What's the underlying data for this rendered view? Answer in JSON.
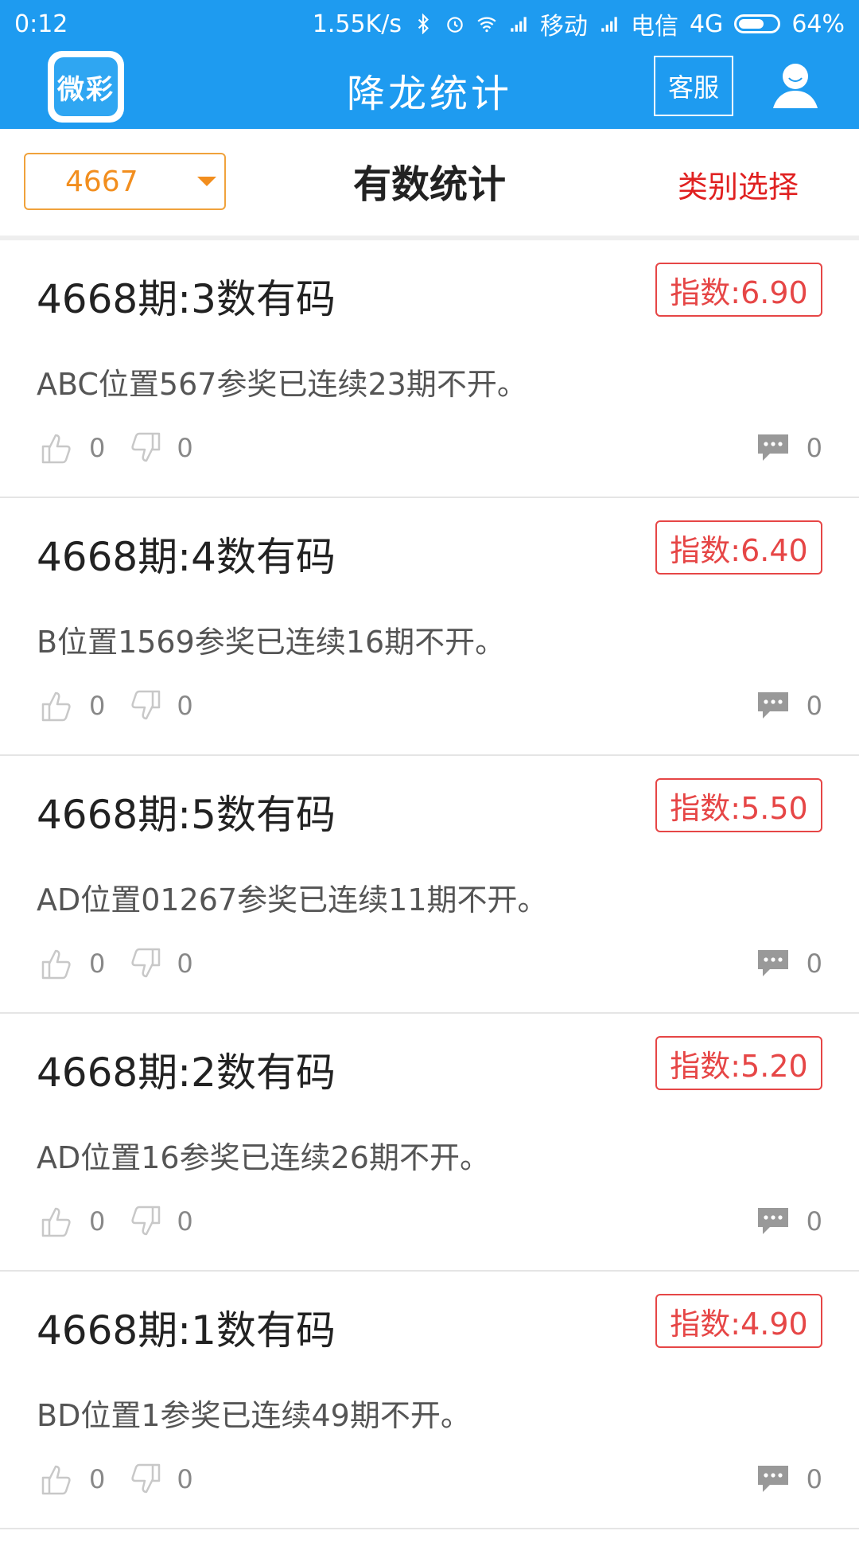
{
  "statusbar": {
    "time": "0:12",
    "speed": "1.55K/s",
    "carrier1": "移动",
    "carrier2": "电信",
    "network": "4G",
    "battery": "64%",
    "battery_level": 0.64
  },
  "header": {
    "logo_text": "微彩",
    "title": "降龙统计",
    "service_label": "客服",
    "icons": [
      "logo-icon",
      "user-avatar-icon"
    ]
  },
  "toolbar": {
    "period_select": "4667",
    "center_title": "有数统计",
    "category_label": "类别选择"
  },
  "items": [
    {
      "heading": "4668期:3数有码",
      "index": "指数:6.90",
      "desc": "ABC位置567参奖已连续23期不开。",
      "likes": "0",
      "dislikes": "0",
      "comments": "0"
    },
    {
      "heading": "4668期:4数有码",
      "index": "指数:6.40",
      "desc": "B位置1569参奖已连续16期不开。",
      "likes": "0",
      "dislikes": "0",
      "comments": "0"
    },
    {
      "heading": "4668期:5数有码",
      "index": "指数:5.50",
      "desc": "AD位置01267参奖已连续11期不开。",
      "likes": "0",
      "dislikes": "0",
      "comments": "0"
    },
    {
      "heading": "4668期:2数有码",
      "index": "指数:5.20",
      "desc": "AD位置16参奖已连续26期不开。",
      "likes": "0",
      "dislikes": "0",
      "comments": "0"
    },
    {
      "heading": "4668期:1数有码",
      "index": "指数:4.90",
      "desc": "BD位置1参奖已连续49期不开。",
      "likes": "0",
      "dislikes": "0",
      "comments": "0"
    }
  ],
  "colors": {
    "brand_blue": "#1E9BF0",
    "accent_orange": "#F28E1E",
    "accent_red": "#E02020",
    "badge_red": "#E64646"
  }
}
